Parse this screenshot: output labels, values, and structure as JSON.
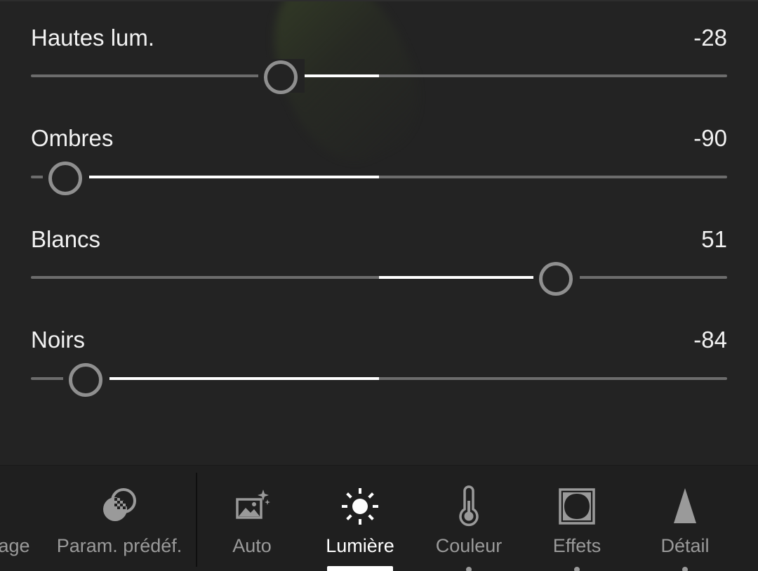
{
  "sliders": [
    {
      "label": "Hautes lum.",
      "value": "-28",
      "min": -100,
      "max": 100,
      "numeric": -28
    },
    {
      "label": "Ombres",
      "value": "-90",
      "min": -100,
      "max": 100,
      "numeric": -90
    },
    {
      "label": "Blancs",
      "value": "51",
      "min": -100,
      "max": 100,
      "numeric": 51
    },
    {
      "label": "Noirs",
      "value": "-84",
      "min": -100,
      "max": 100,
      "numeric": -84
    }
  ],
  "toolbar": {
    "items": [
      {
        "label": "age",
        "icon": "none"
      },
      {
        "label": "Param. prédéf.",
        "icon": "presets-icon"
      },
      {
        "label": "Auto",
        "icon": "auto-icon"
      },
      {
        "label": "Lumière",
        "icon": "sun-icon",
        "active": true
      },
      {
        "label": "Couleur",
        "icon": "thermometer-icon"
      },
      {
        "label": "Effets",
        "icon": "effects-icon"
      },
      {
        "label": "Détail",
        "icon": "detail-triangle-icon"
      }
    ]
  },
  "colors": {
    "background": "#232323",
    "track": "#6c6c6c",
    "fill": "#ffffff",
    "thumb": "#8f8f8f",
    "inactive_label": "#9a9a9a",
    "active_label": "#ffffff"
  }
}
